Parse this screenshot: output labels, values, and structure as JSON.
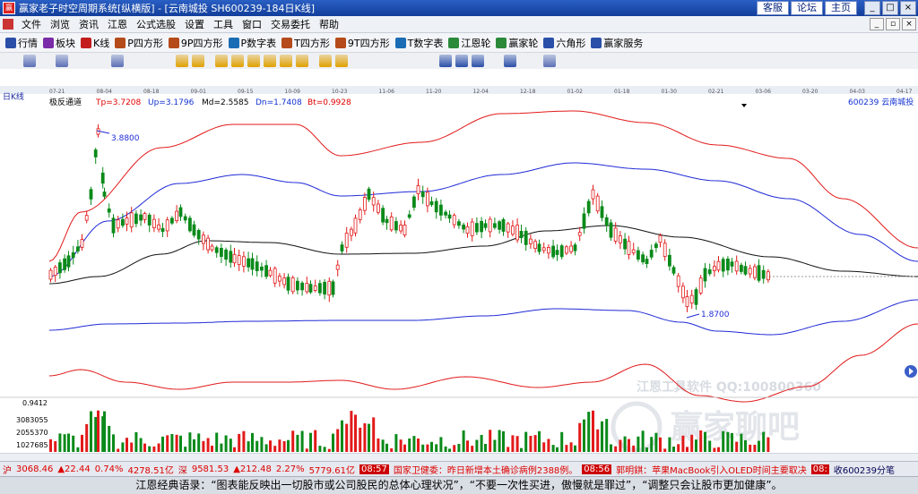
{
  "window": {
    "title": "赢家老子时空周期系统[纵横版] - [云南城投  SH600239-184日K线]",
    "links": [
      "客服",
      "论坛",
      "主页"
    ],
    "controls": [
      "_",
      "□",
      "×"
    ]
  },
  "menu": [
    "文件",
    "浏览",
    "资讯",
    "江恩",
    "公式选股",
    "设置",
    "工具",
    "窗口",
    "交易委托",
    "帮助"
  ],
  "toolbar": [
    {
      "label": "行情",
      "icon": "grid-icon"
    },
    {
      "label": "板块",
      "icon": "blocks-icon"
    },
    {
      "label": "K线",
      "icon": "candlestick-icon"
    },
    {
      "label": "P四方形",
      "icon": "p-square-icon"
    },
    {
      "label": "9P四方形",
      "icon": "9p-square-icon"
    },
    {
      "label": "P数字表",
      "icon": "p-table-icon"
    },
    {
      "label": "T四方形",
      "icon": "t-square-icon"
    },
    {
      "label": "9T四方形",
      "icon": "9t-square-icon"
    },
    {
      "label": "T数字表",
      "icon": "t-table-icon"
    },
    {
      "label": "江恩轮",
      "icon": "gann-wheel-icon"
    },
    {
      "label": "赢家轮",
      "icon": "winner-wheel-icon"
    },
    {
      "label": "六角形",
      "icon": "hexagon-icon"
    },
    {
      "label": "赢家服务",
      "icon": "service-icon"
    }
  ],
  "chart": {
    "period": "日K线",
    "dates": [
      "07-21",
      "08-04",
      "08-18",
      "09-01",
      "09-15",
      "10-09",
      "10-23",
      "11-06",
      "11-20",
      "12-04",
      "12-18",
      "01-02",
      "01-18",
      "01-30",
      "02-21",
      "03-06",
      "03-20",
      "04-03",
      "04-17"
    ],
    "indicator": {
      "name": "极反通道",
      "tp": "Tp=3.7208",
      "up": "Up=3.1796",
      "md": "Md=2.5585",
      "dn": "Dn=1.7408",
      "bt": "Bt=0.9928"
    },
    "stock": "600239  云南城投",
    "high_label": "3.8800",
    "low_label": "1.8700",
    "volume_axis": [
      "0.9412",
      "3083055",
      "2055370",
      "1027685"
    ],
    "watermark": [
      "江恩工具软件  QQ:100800360",
      "赢家聊吧"
    ]
  },
  "status": {
    "sh_index": "3068.46",
    "sh_change": "▲22.44",
    "sh_pct": "0.74%",
    "sh_amount": "4278.51亿",
    "sz_index": "9581.53",
    "sz_change": "▲212.48",
    "sz_pct": "2.27%",
    "sz_amount": "5779.61亿",
    "news1_time": "08:57",
    "news1": "国家卫健委：昨日新增本土确诊病例2388例。",
    "news2_time": "08:56",
    "news2": "郭明錤：苹果MacBook引入OLED时间主要取决",
    "news3_time": "08:",
    "news3": "收600239分笔"
  },
  "quote": "江恩经典语录：“图表能反映出一切股市或公司股民的总体心理状况”，“不要一次性买进，傲慢就是罪过”，“调整只会让股市更加健康”。",
  "chart_data": {
    "type": "candlestick",
    "title": "云南城投 600239 日K线 极反通道",
    "indicator": "极反通道",
    "channel_values": {
      "Tp": 3.7208,
      "Up": 3.1796,
      "Md": 2.5585,
      "Dn": 1.7408,
      "Bt": 0.9928
    },
    "annotations": [
      {
        "text": "3.8800",
        "type": "high"
      },
      {
        "text": "1.8700",
        "type": "low"
      }
    ],
    "x_ticks": [
      "07-21",
      "08-04",
      "08-18",
      "09-01",
      "09-15",
      "10-09",
      "10-23",
      "11-06",
      "11-20",
      "12-04",
      "12-18",
      "01-02",
      "01-18",
      "01-30",
      "02-21",
      "03-06",
      "03-20",
      "04-03",
      "04-17"
    ],
    "volume_ticks": [
      3083055,
      2055370,
      1027685
    ]
  }
}
